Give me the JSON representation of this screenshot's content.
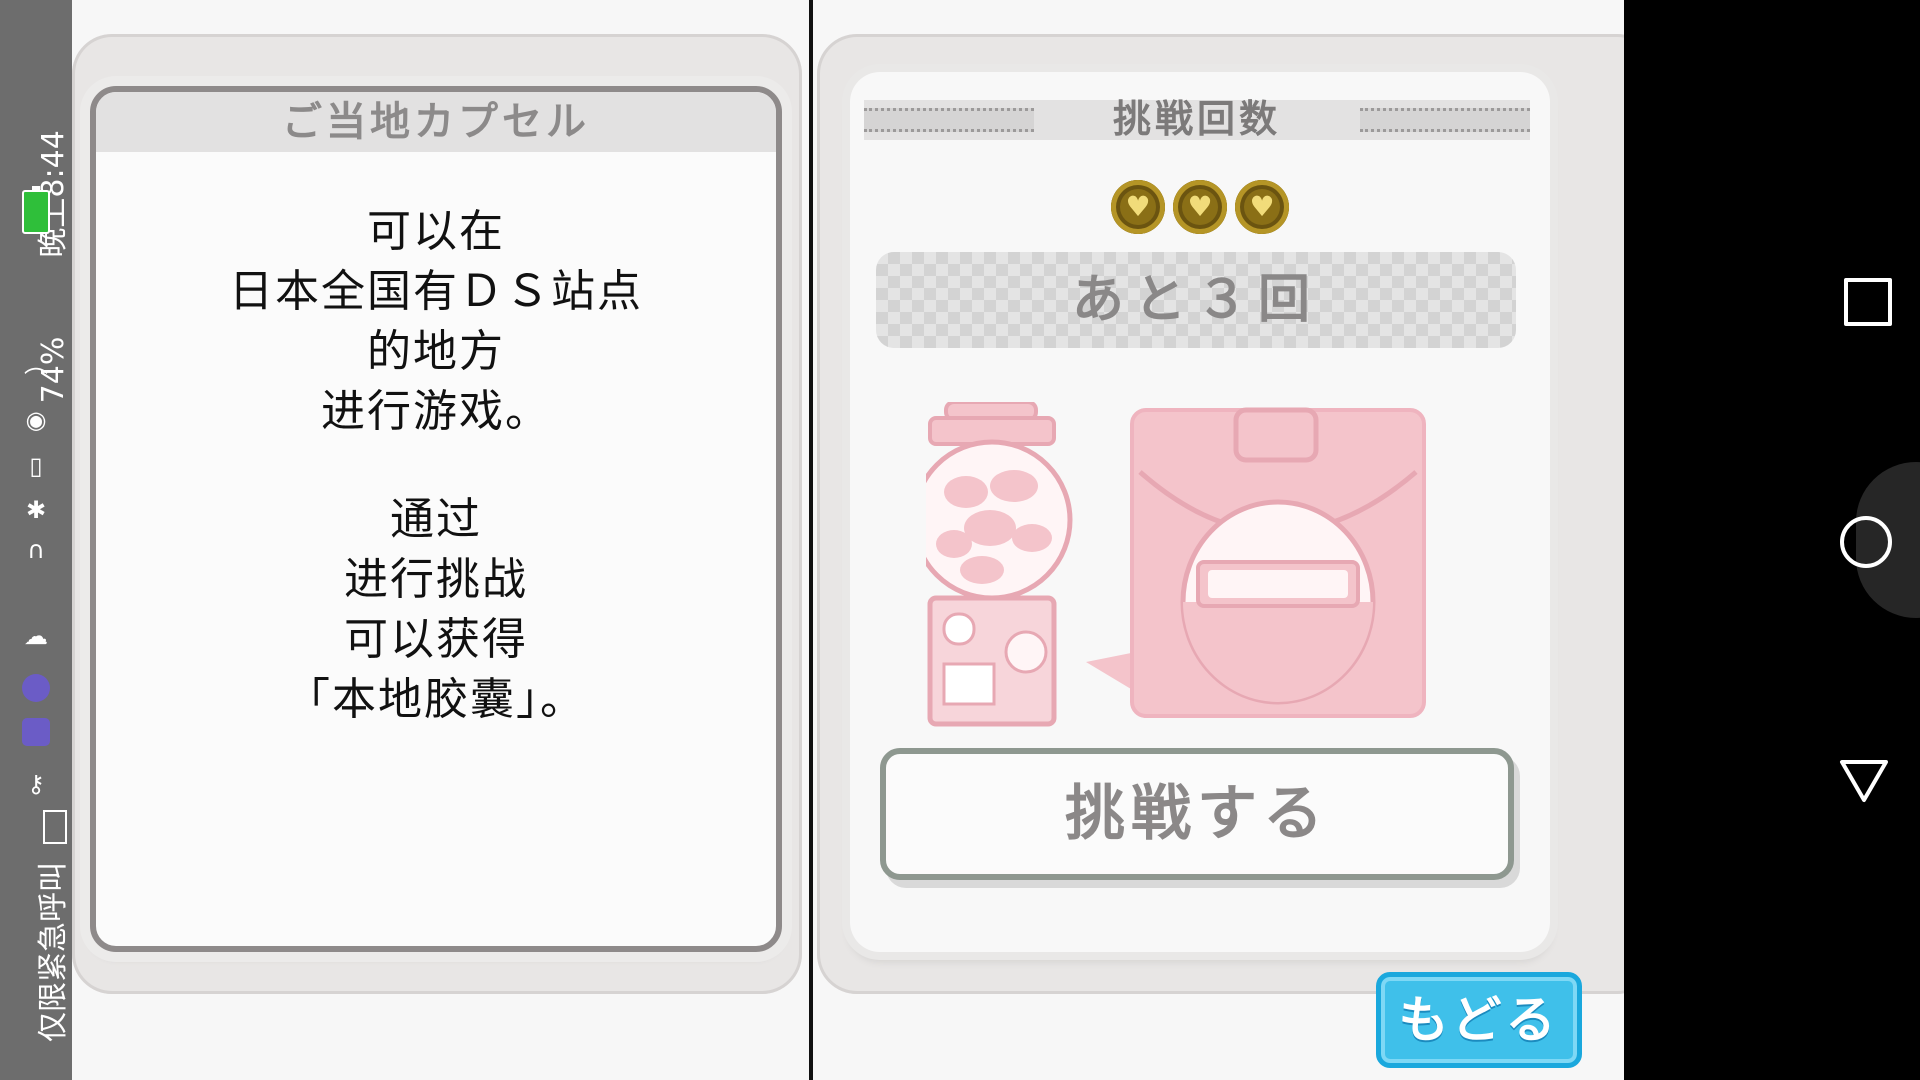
{
  "status_bar": {
    "text": "仅限紧急呼叫",
    "battery_percent": "74%",
    "time": "晚上8:44",
    "icons": [
      "sim-icon",
      "key-icon",
      "app-a-icon",
      "app-b-icon",
      "cloud-icon",
      "headset-icon",
      "bluetooth-icon",
      "vibrate-icon",
      "eye-icon",
      "wifi-icon",
      "battery-icon"
    ]
  },
  "left_panel": {
    "title": "ご当地カプセル",
    "desc_line1": "可以在",
    "desc_line2": "日本全国有ＤＳ站点",
    "desc_line3": "的地方",
    "desc_line4": "进行游戏。",
    "desc_line5": "通过",
    "desc_line6": "进行挑战",
    "desc_line7": "可以获得",
    "desc_line8": "「本地胶囊」。"
  },
  "right_panel": {
    "attempts_title": "挑戦回数",
    "coin_count": 3,
    "remaining_text": "あと３回",
    "challenge_button": "挑戦する",
    "back_button": "もどる"
  },
  "colors": {
    "back_button": "#3fc0ea",
    "illustration_pink": "#f4c4cb",
    "coin_gold": "#8a6f16"
  },
  "navigation": {
    "icons": [
      "recents-icon",
      "home-icon",
      "back-icon"
    ]
  }
}
